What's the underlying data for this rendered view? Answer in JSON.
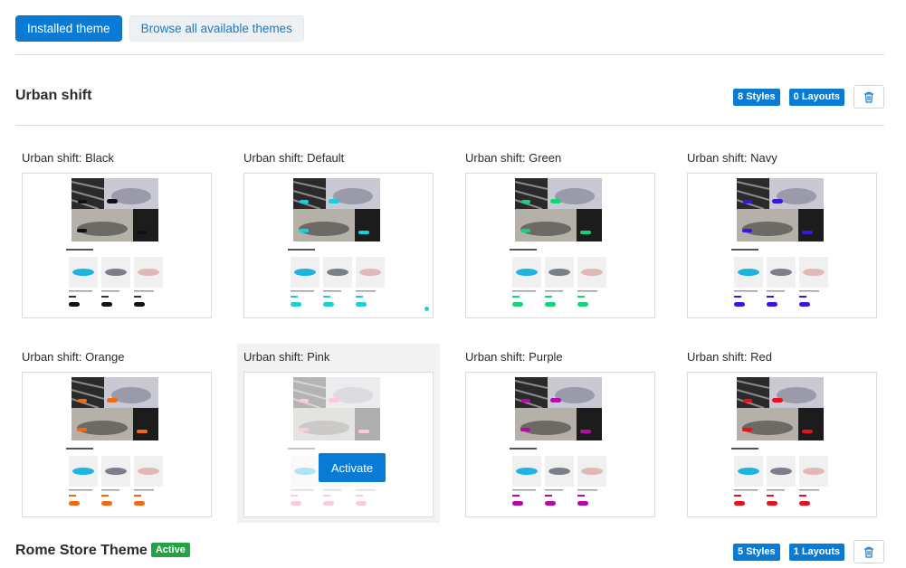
{
  "tabs": {
    "installed": "Installed theme",
    "browse": "Browse all available themes"
  },
  "themes": [
    {
      "title": "Urban shift",
      "styles_badge": "8 Styles",
      "layouts_badge": "0 Layouts"
    },
    {
      "title": "Rome Store Theme",
      "active_label": "Active",
      "styles_badge": "5 Styles",
      "layouts_badge": "1 Layouts"
    }
  ],
  "styles": [
    {
      "label": "Urban shift: Black",
      "accent": "#111111"
    },
    {
      "label": "Urban shift: Default",
      "accent": "#1ccdde"
    },
    {
      "label": "Urban shift: Green",
      "accent": "#16d27a"
    },
    {
      "label": "Urban shift: Navy",
      "accent": "#3a16e0"
    },
    {
      "label": "Urban shift: Orange",
      "accent": "#f26a10"
    },
    {
      "label": "Urban shift: Pink",
      "accent": "#f56aa8"
    },
    {
      "label": "Urban shift: Purple",
      "accent": "#b40aa8"
    },
    {
      "label": "Urban shift: Red",
      "accent": "#e8101e"
    }
  ],
  "activate_label": "Activate",
  "icons": {
    "delete": "trash-icon"
  }
}
